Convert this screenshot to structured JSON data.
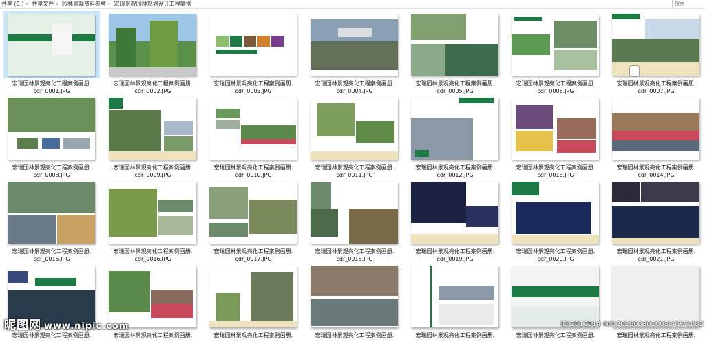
{
  "address_bar": {
    "crumbs": [
      "共享 (E:)",
      "共享文件",
      "园林景观资料参考",
      "宏瑞景观园林规划设计工程案例"
    ],
    "search_placeholder": "搜索"
  },
  "files": [
    {
      "line1": "宏瑞园林景观亮化工程案例画册.",
      "line2": "cdr_0001.JPG"
    },
    {
      "line1": "宏瑞园林景观亮化工程案例画册.",
      "line2": "cdr_0002.JPG"
    },
    {
      "line1": "宏瑞园林景观亮化工程案例画册.",
      "line2": "cdr_0003.JPG"
    },
    {
      "line1": "宏瑞园林景观亮化工程案例画册.",
      "line2": "cdr_0004.JPG"
    },
    {
      "line1": "宏瑞园林景观亮化工程案例画册.",
      "line2": "cdr_0005.JPG"
    },
    {
      "line1": "宏瑞园林景观亮化工程案例画册.",
      "line2": "cdr_0006.JPG"
    },
    {
      "line1": "宏瑞园林景观亮化工程案例画册.",
      "line2": "cdr_0007.JPG"
    },
    {
      "line1": "宏瑞园林景观亮化工程案例画册.",
      "line2": "cdr_0008.JPG"
    },
    {
      "line1": "宏瑞园林景观亮化工程案例画册.",
      "line2": "cdr_0009.JPG"
    },
    {
      "line1": "宏瑞园林景观亮化工程案例画册.",
      "line2": "cdr_0010.JPG"
    },
    {
      "line1": "宏瑞园林景观亮化工程案例画册.",
      "line2": "cdr_0011.JPG"
    },
    {
      "line1": "宏瑞园林景观亮化工程案例画册.",
      "line2": "cdr_0012.JPG"
    },
    {
      "line1": "宏瑞园林景观亮化工程案例画册.",
      "line2": "cdr_0013.JPG"
    },
    {
      "line1": "宏瑞园林景观亮化工程案例画册.",
      "line2": "cdr_0014.JPG"
    },
    {
      "line1": "宏瑞园林景观亮化工程案例画册.",
      "line2": "cdr_0015.JPG"
    },
    {
      "line1": "宏瑞园林景观亮化工程案例画册.",
      "line2": "cdr_0016.JPG"
    },
    {
      "line1": "宏瑞园林景观亮化工程案例画册.",
      "line2": "cdr_0017.JPG"
    },
    {
      "line1": "宏瑞园林景观亮化工程案例画册.",
      "line2": "cdr_0018.JPG"
    },
    {
      "line1": "宏瑞园林景观亮化工程案例画册.",
      "line2": "cdr_0019.JPG"
    },
    {
      "line1": "宏瑞园林景观亮化工程案例画册.",
      "line2": "cdr_0020.JPG"
    },
    {
      "line1": "宏瑞园林景观亮化工程案例画册.",
      "line2": "cdr_0021.JPG"
    },
    {
      "line1": "宏瑞园林景观亮化工程案例画册.",
      "line2": ""
    },
    {
      "line1": "宏瑞园林景观亮化工程案例画册.",
      "line2": ""
    },
    {
      "line1": "宏瑞园林景观亮化工程案例画册.",
      "line2": ""
    },
    {
      "line1": "宏瑞园林景观亮化工程案例画册.",
      "line2": ""
    },
    {
      "line1": "宏瑞园林景观亮化工程案例画册.",
      "line2": ""
    },
    {
      "line1": "宏瑞园林景观亮化工程案例画册.",
      "line2": ""
    },
    {
      "line1": "宏瑞园林景观亮化工程案例画册.",
      "line2": ""
    }
  ],
  "watermarks": {
    "left_logo": "昵图网",
    "left_url": "www.nipic.com",
    "right_id": "ID:2012514 NO:20200330100834971082"
  },
  "colors": {
    "brand_green": "#1e7a45",
    "selection": "#cce8ff",
    "beige": "#efe3bf"
  }
}
